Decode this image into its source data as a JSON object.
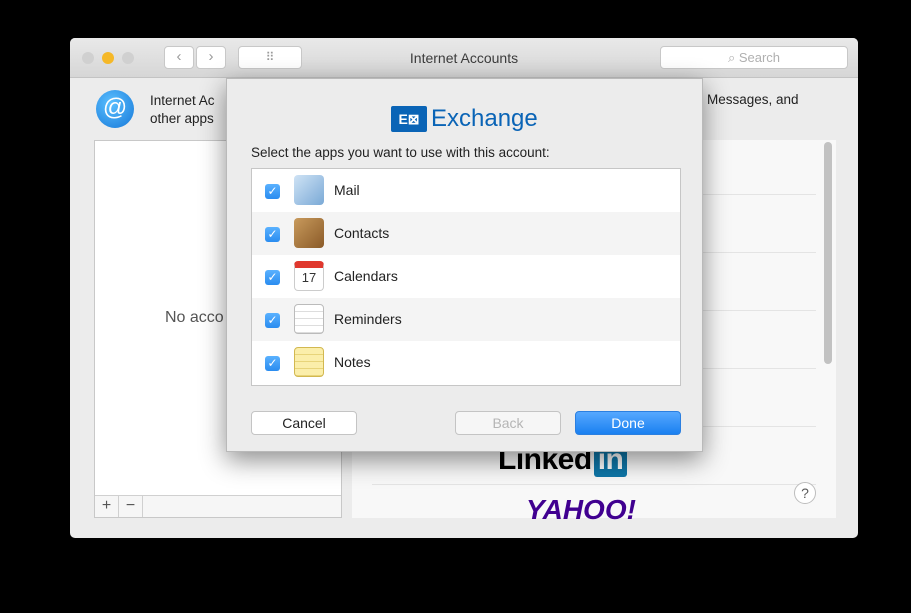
{
  "window": {
    "title": "Internet Accounts",
    "search_placeholder": "Search",
    "grid_icon": "⠿",
    "back_arrow": "‹",
    "forward_arrow": "›",
    "header_left_line1": "Internet Ac",
    "header_left_line2": "other apps",
    "header_right": "Messages, and",
    "at_symbol": "@"
  },
  "accounts_list": {
    "empty_text": "No acco",
    "add_label": "+",
    "remove_label": "−"
  },
  "providers": {
    "linkedin_text": "Linked",
    "linkedin_in": "in",
    "yahoo_text": "YAHOO!",
    "help_label": "?"
  },
  "sheet": {
    "brand_icon_text": "E⊠",
    "brand_name": "Exchange",
    "prompt": "Select the apps you want to use with this account:",
    "apps": [
      {
        "label": "Mail",
        "checked": true,
        "icon": "mail-icon",
        "color": "#7aa9d6"
      },
      {
        "label": "Contacts",
        "checked": true,
        "icon": "contacts-icon",
        "color": "#a0713c"
      },
      {
        "label": "Calendars",
        "checked": true,
        "icon": "calendar-icon",
        "color": "#ffffff",
        "day": "17"
      },
      {
        "label": "Reminders",
        "checked": true,
        "icon": "reminders-icon",
        "color": "#ffffff"
      },
      {
        "label": "Notes",
        "checked": true,
        "icon": "notes-icon",
        "color": "#f7e38a"
      }
    ],
    "checkmark": "✓",
    "cancel_label": "Cancel",
    "back_label": "Back",
    "done_label": "Done"
  },
  "colors": {
    "accent": "#1a80f0",
    "exchange_blue": "#0a64b6",
    "linkedin_blue": "#0e76a8",
    "yahoo_purple": "#400090"
  }
}
